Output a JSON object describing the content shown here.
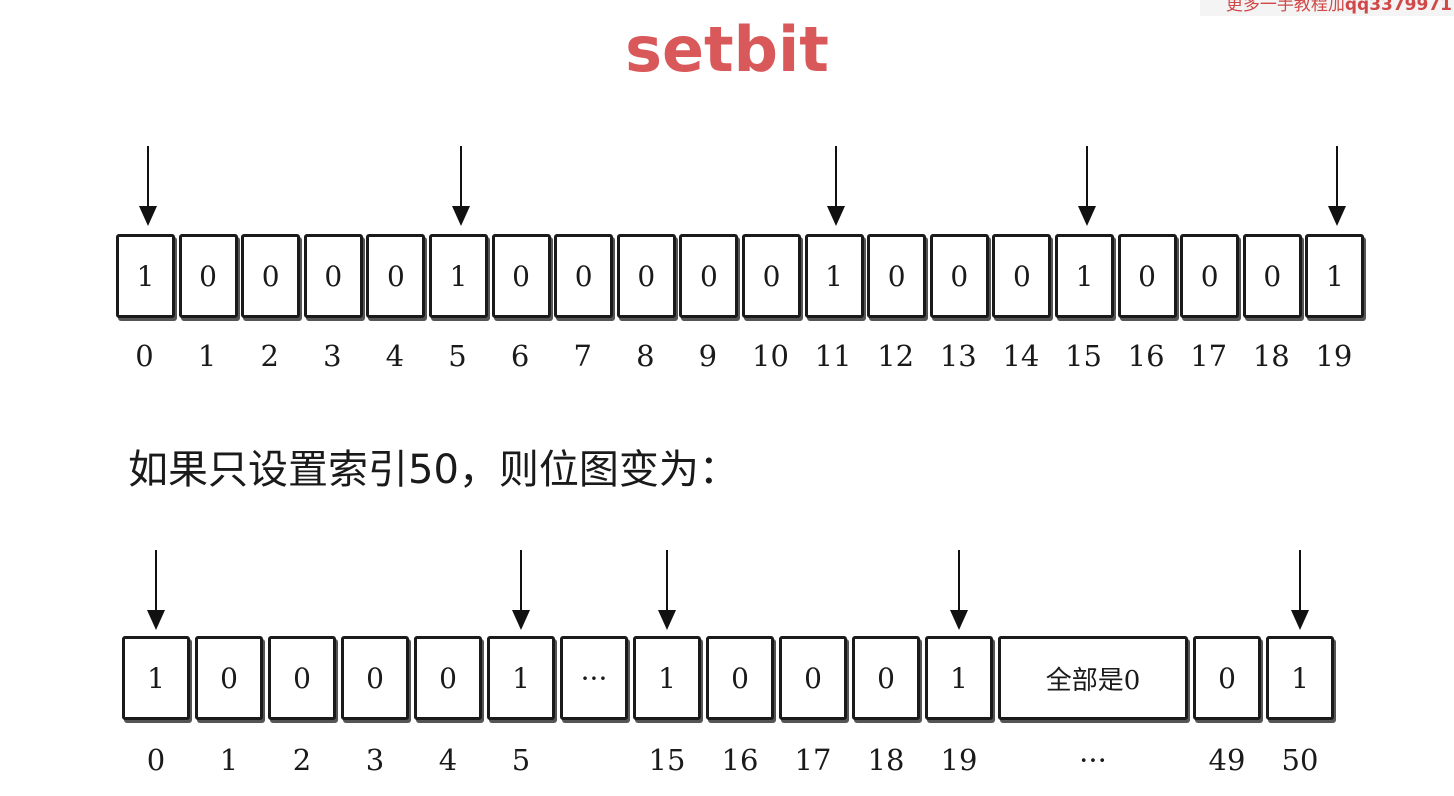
{
  "watermark": {
    "text": "更多一手教程加",
    "qq": "qq3379971"
  },
  "title": "setbit",
  "caption": "如果只设置索引50，则位图变为：",
  "top_row": {
    "cells": [
      "1",
      "0",
      "0",
      "0",
      "0",
      "1",
      "0",
      "0",
      "0",
      "0",
      "0",
      "1",
      "0",
      "0",
      "0",
      "1",
      "0",
      "0",
      "0",
      "1"
    ],
    "indices": [
      "0",
      "1",
      "2",
      "3",
      "4",
      "5",
      "6",
      "7",
      "8",
      "9",
      "10",
      "11",
      "12",
      "13",
      "14",
      "15",
      "16",
      "17",
      "18",
      "19"
    ],
    "arrows_at": [
      0,
      5,
      11,
      15,
      19
    ]
  },
  "bottom_row": {
    "cells": [
      {
        "text": "1",
        "wide": false
      },
      {
        "text": "0",
        "wide": false
      },
      {
        "text": "0",
        "wide": false
      },
      {
        "text": "0",
        "wide": false
      },
      {
        "text": "0",
        "wide": false
      },
      {
        "text": "1",
        "wide": false
      },
      {
        "text": "···",
        "wide": false
      },
      {
        "text": "1",
        "wide": false
      },
      {
        "text": "0",
        "wide": false
      },
      {
        "text": "0",
        "wide": false
      },
      {
        "text": "0",
        "wide": false
      },
      {
        "text": "1",
        "wide": false
      },
      {
        "text": "全部是0",
        "wide": true
      },
      {
        "text": "0",
        "wide": false
      },
      {
        "text": "1",
        "wide": false
      }
    ],
    "indices": [
      "0",
      "1",
      "2",
      "3",
      "4",
      "5",
      "",
      "15",
      "16",
      "17",
      "18",
      "19",
      "···",
      "49",
      "50"
    ],
    "arrows_at": [
      0,
      5,
      7,
      11,
      14
    ]
  }
}
